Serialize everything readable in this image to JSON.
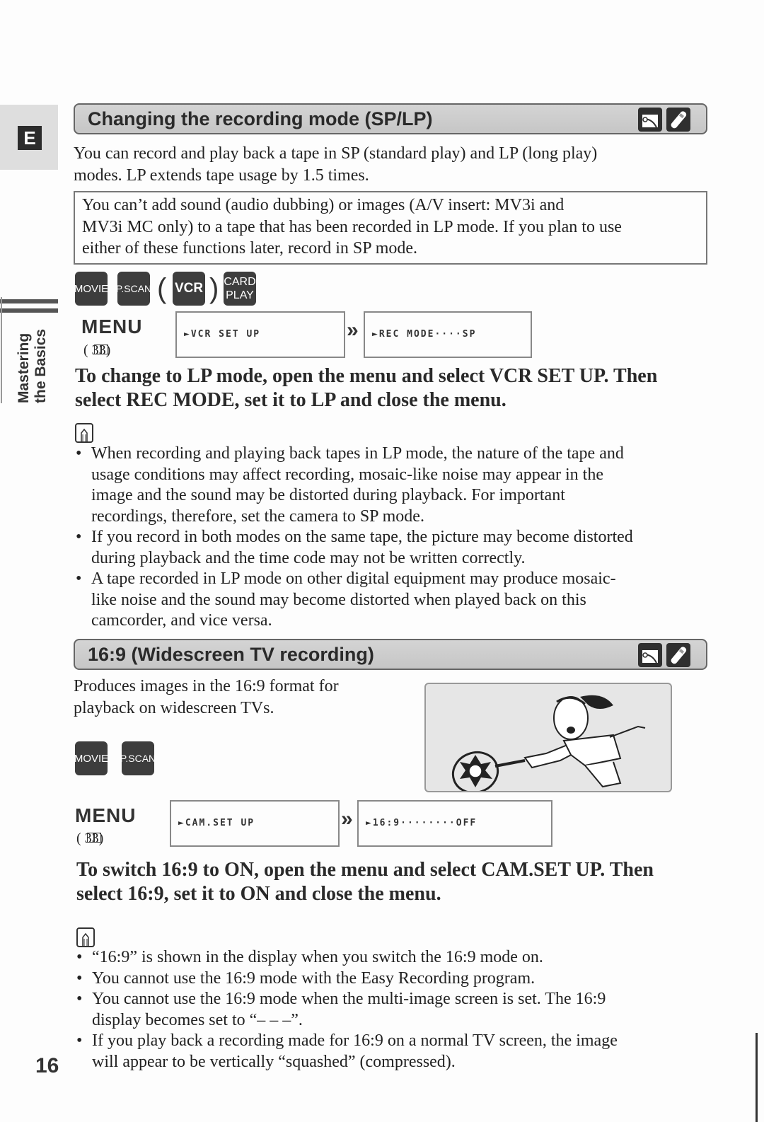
{
  "sidebar": {
    "language_tab": "E",
    "section_label_line1": "Mastering",
    "section_label_line2": "the Basics"
  },
  "section1": {
    "title": "Changing the recording mode (SP/LP)",
    "header_icons": [
      "tape-cassette-icon",
      "wireless-controller-icon"
    ],
    "intro_line1": "You can record and play back a tape in SP (standard play) and LP (long play)",
    "intro_line2": "modes. LP extends tape usage by 1.5 times.",
    "note_line1": "You can’t add sound (audio dubbing) or images (A/V insert: MV3i and",
    "note_line2": "MV3i MC only) to a tape that has been recorded in LP mode. If you plan to use",
    "note_line3": "either of these functions later, record in SP mode.",
    "mode_buttons": [
      {
        "label": "MOVIE"
      },
      {
        "label": "P.SCAN"
      },
      {
        "label": "VCR"
      },
      {
        "label_line1": "CARD",
        "label_line2": "PLAY"
      }
    ],
    "paren_open": "(",
    "paren_close": ")",
    "menu_label": "MENU",
    "menu_ref": "(  33)",
    "lcd1": "►VCR SET UP",
    "lcd2": "►REC MODE····SP",
    "instruction_line1": "To change to LP mode, open the menu and select VCR SET UP. Then",
    "instruction_line2": "select REC MODE, set it to LP and close the menu.",
    "notes": [
      {
        "line1": "When recording and playing back tapes in LP mode, the nature of the tape and",
        "line2": "usage conditions may affect recording, mosaic-like noise may appear in the",
        "line3": "image and the sound may be distorted during playback. For important",
        "line4": "recordings, therefore, set the camera to SP mode."
      },
      {
        "line1": "If you record in both modes on the same tape, the picture may become distorted",
        "line2": "during playback and the time code may not be written correctly."
      },
      {
        "line1": "A tape recorded in LP mode on other digital equipment may produce mosaic-",
        "line2": "like noise and the sound may become distorted when played back on this",
        "line3": "camcorder, and vice versa."
      }
    ]
  },
  "section2": {
    "title": "16:9 (Widescreen TV recording)",
    "header_icons": [
      "tape-cassette-icon",
      "wireless-controller-icon"
    ],
    "intro_line1": "Produces images in the 16:9 format for",
    "intro_line2": "playback on widescreen TVs.",
    "illustration": "girl-playing-tennis-illustration",
    "mode_buttons": [
      {
        "label": "MOVIE"
      },
      {
        "label": "P.SCAN"
      }
    ],
    "menu_label": "MENU",
    "menu_ref": "(  33)",
    "lcd1": "►CAM.SET UP",
    "lcd2": "►16:9········OFF",
    "instruction_line1": "To switch 16:9 to ON, open the menu and select CAM.SET UP. Then",
    "instruction_line2": "select 16:9, set it to ON and close the menu.",
    "notes": [
      {
        "line1": "“16:9” is shown in the display when you switch the 16:9 mode on."
      },
      {
        "line1": "You cannot use the 16:9 mode with the Easy Recording program."
      },
      {
        "line1": "You cannot use the 16:9 mode when the multi-image screen is set. The 16:9",
        "line2": "display becomes set to “– – –”."
      },
      {
        "line1": "If you play back a recording made for 16:9 on a normal TV screen, the image",
        "line2": "will appear to be vertically “squashed” (compressed)."
      }
    ]
  },
  "page_number": "16"
}
